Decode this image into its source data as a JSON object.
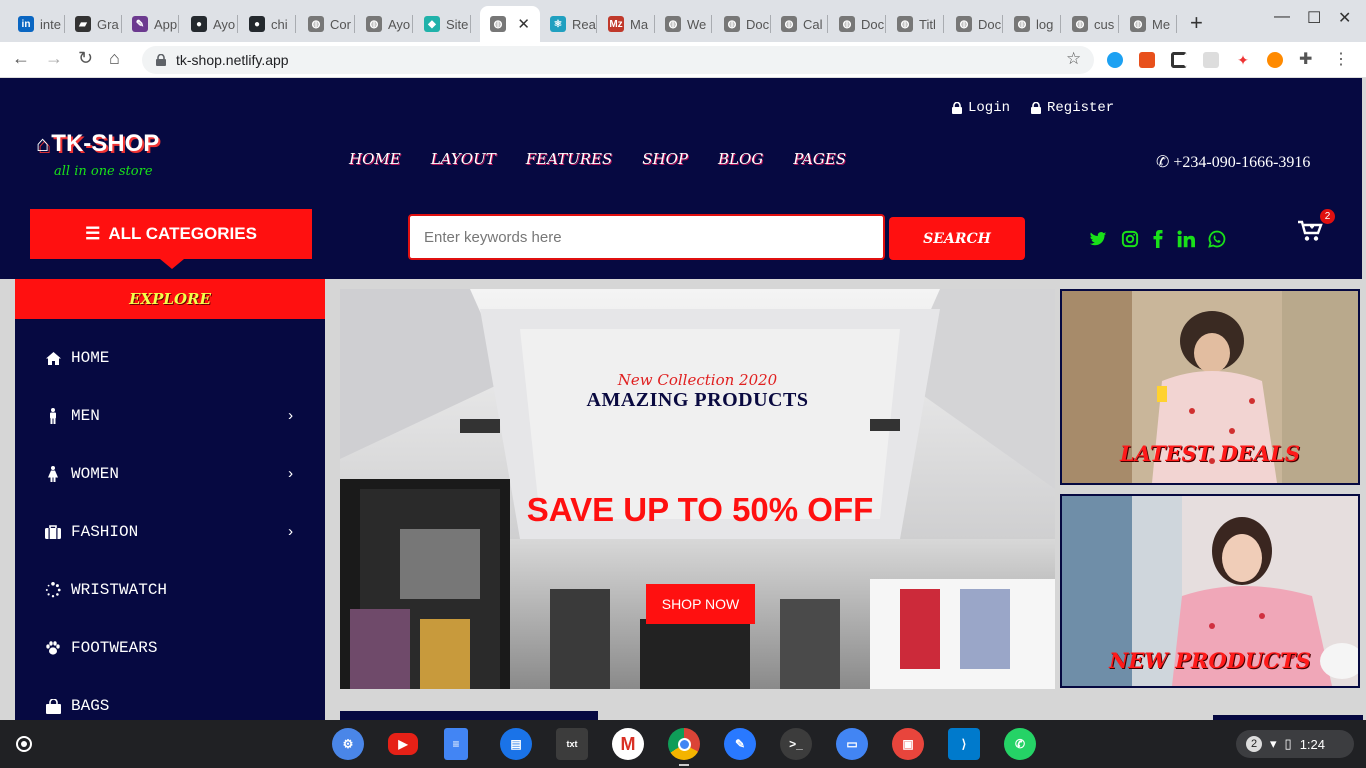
{
  "browser": {
    "tabs": [
      {
        "label": "inte",
        "icon": "linkedin-icon",
        "color": "#0a66c2",
        "glyph": "in"
      },
      {
        "label": "Gra",
        "icon": "briefcase-icon",
        "color": "#333333",
        "glyph": "▰"
      },
      {
        "label": "App",
        "icon": "pencil-icon",
        "color": "#6c3a8f",
        "glyph": "✎"
      },
      {
        "label": "Ayo",
        "icon": "github-icon",
        "color": "#24292e",
        "glyph": "●"
      },
      {
        "label": "chi",
        "icon": "github-icon",
        "color": "#24292e",
        "glyph": "●"
      },
      {
        "label": "Cor",
        "icon": "globe-icon",
        "color": "#777777",
        "glyph": "◍"
      },
      {
        "label": "Ayo",
        "icon": "globe-icon",
        "color": "#777777",
        "glyph": "◍"
      },
      {
        "label": "Site",
        "icon": "netlify-icon",
        "color": "#20b2aa",
        "glyph": "◆"
      },
      {
        "label": "",
        "icon": "globe-icon",
        "color": "#777777",
        "glyph": "◍",
        "active": true
      },
      {
        "label": "Rea",
        "icon": "react-icon",
        "color": "#20a0c0",
        "glyph": "⚛"
      },
      {
        "label": "Ma",
        "icon": "mz-icon",
        "color": "#c0392b",
        "glyph": "Mz"
      },
      {
        "label": "We",
        "icon": "globe-icon",
        "color": "#777777",
        "glyph": "◍"
      },
      {
        "label": "Doc",
        "icon": "globe-icon",
        "color": "#777777",
        "glyph": "◍"
      },
      {
        "label": "Cal",
        "icon": "globe-icon",
        "color": "#777777",
        "glyph": "◍"
      },
      {
        "label": "Doc",
        "icon": "globe-icon",
        "color": "#777777",
        "glyph": "◍"
      },
      {
        "label": "Titl",
        "icon": "globe-icon",
        "color": "#777777",
        "glyph": "◍"
      },
      {
        "label": "Doc",
        "icon": "globe-icon",
        "color": "#777777",
        "glyph": "◍"
      },
      {
        "label": "log",
        "icon": "globe-icon",
        "color": "#777777",
        "glyph": "◍"
      },
      {
        "label": "cus",
        "icon": "globe-icon",
        "color": "#777777",
        "glyph": "◍"
      },
      {
        "label": "Me",
        "icon": "globe-icon",
        "color": "#777777",
        "glyph": "◍"
      }
    ],
    "url": "tk-shop.netlify.app"
  },
  "site": {
    "login": "Login",
    "register": "Register",
    "logo": "TK-SHOP",
    "tagline": "all in one store",
    "nav": [
      "HOME",
      "LAYOUT",
      "FEATURES",
      "SHOP",
      "BLOG",
      "PAGES"
    ],
    "phone": "+234-090-1666-3916",
    "all_categories": "ALL CATEGORIES",
    "search_placeholder": "Enter keywords here",
    "search_button": "SEARCH",
    "cart_count": "2",
    "explore": "EXPLORE",
    "categories": [
      {
        "label": "HOME",
        "icon": "home-icon",
        "submenu": false
      },
      {
        "label": "MEN",
        "icon": "male-icon",
        "submenu": true
      },
      {
        "label": "WOMEN",
        "icon": "female-icon",
        "submenu": true
      },
      {
        "label": "FASHION",
        "icon": "briefcase-icon",
        "submenu": true
      },
      {
        "label": "WRISTWATCH",
        "icon": "spinner-icon",
        "submenu": false
      },
      {
        "label": "FOOTWEARS",
        "icon": "paw-icon",
        "submenu": false
      },
      {
        "label": "BAGS",
        "icon": "shopping-bag-icon",
        "submenu": false
      }
    ],
    "hero": {
      "kicker": "New Collection 2020",
      "title": "AMAZING PRODUCTS",
      "offer": "SAVE UP TO 50% OFF",
      "button": "SHOP NOW"
    },
    "promo": {
      "latest": "LATEST DEALS",
      "new": "NEW PRODUCTS"
    }
  },
  "taskbar": {
    "notifications": "2",
    "time": "1:24"
  },
  "colors": {
    "navy": "#060941",
    "red": "#ff1010",
    "green": "#19e019"
  }
}
